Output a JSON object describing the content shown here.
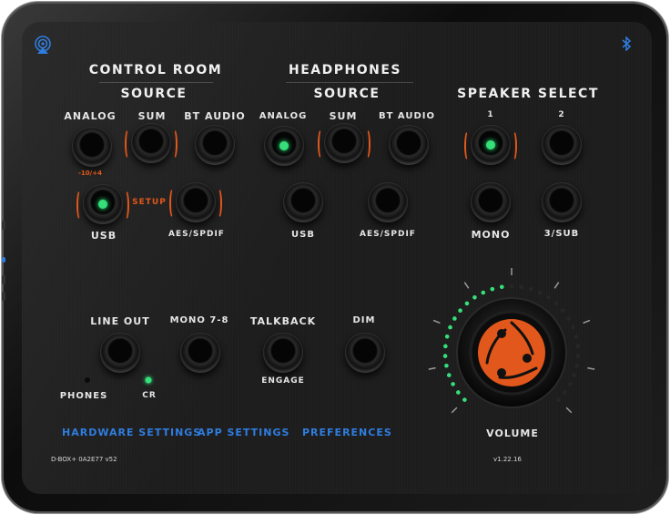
{
  "control_room": {
    "title": "CONTROL ROOM",
    "source_title": "SOURCE",
    "sources": [
      {
        "label": "ANALOG",
        "active": false,
        "selected": false
      },
      {
        "label": "SUM",
        "active": false,
        "selected": true
      },
      {
        "label": "BT AUDIO",
        "active": false,
        "selected": false
      },
      {
        "label": "USB",
        "active": true,
        "selected": true
      },
      {
        "label": "AES/SPDIF",
        "active": false,
        "selected": true
      }
    ],
    "trim_label": "-10/+4",
    "setup_label": "SETUP"
  },
  "headphones": {
    "title": "HEADPHONES",
    "source_title": "SOURCE",
    "sources": [
      {
        "label": "ANALOG",
        "active": true
      },
      {
        "label": "SUM",
        "active": false,
        "selected": true
      },
      {
        "label": "BT AUDIO",
        "active": false
      },
      {
        "label": "USB",
        "active": false
      },
      {
        "label": "AES/SPDIF",
        "active": false
      }
    ]
  },
  "speaker_select": {
    "title": "SPEAKER SELECT",
    "speakers": [
      {
        "label": "1",
        "active": true
      },
      {
        "label": "2",
        "active": false
      },
      {
        "label": "MONO",
        "active": false
      },
      {
        "label": "3/SUB",
        "active": false
      }
    ]
  },
  "outputs": {
    "line_out": "LINE OUT",
    "mono_78": "MONO 7-8",
    "talkback": "TALKBACK",
    "talkback_sub": "ENGAGE",
    "dim": "DIM",
    "phones": "PHONES",
    "cr": "CR"
  },
  "volume": {
    "label": "VOLUME",
    "level": 0.5
  },
  "links": {
    "hardware": "HARDWARE SETTINGS",
    "app": "APP SETTINGS",
    "preferences": "PREFERENCES"
  },
  "device_id": "D-BOX+ 0A2E77 v52",
  "app_version": "v1.22.16",
  "colors": {
    "accent_orange": "#e2571b",
    "led_green": "#35e07a",
    "link_blue": "#2f7de0"
  },
  "icons": {
    "top_left": "airplay-icon",
    "top_right": "bluetooth-icon"
  }
}
